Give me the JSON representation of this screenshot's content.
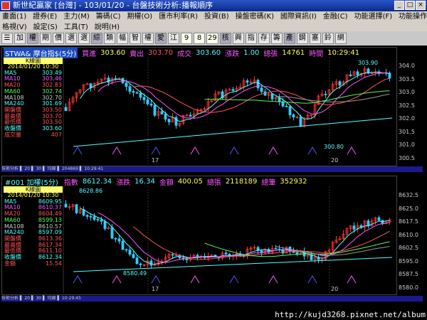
{
  "title": "新世紀贏家 [台灣] - 103/01/20 - 台盤技術分析:播報順序",
  "window_buttons": [
    "_",
    "□",
    "×"
  ],
  "menu": {
    "row1": [
      "畫面(1)",
      "證券(E)",
      "主力(M)",
      "籌碼(C)",
      "期權(O)",
      "匯市利率(R)",
      "投資(B)",
      "操盤密碼(K)",
      "國際資訊(I)",
      "金融(C)",
      "功能選擇(F)",
      "功能操作(F)"
    ],
    "row2": [
      "格視(V)",
      "設定(S)",
      "工具(T)",
      "說明(H)"
    ]
  },
  "toolbar": [
    "☰",
    "加",
    "權",
    "期",
    "價",
    "選",
    "選",
    "綜",
    "類",
    "幅",
    "智",
    "權",
    "愛",
    "江",
    "9",
    "8",
    "29",
    "核",
    "興",
    "指",
    "存",
    "籌",
    "產",
    "鋼",
    "塞",
    "鈴",
    "網"
  ],
  "panel1": {
    "symbol": "STWA& 摩台指$(5分)",
    "bid_label": "買進",
    "bid": "303.60",
    "ask_label": "賣出",
    "ask": "303.70",
    "deal_label": "成交",
    "deal": "303.60",
    "change_label": "漲跌",
    "change": "1.00",
    "volume_label": "總張",
    "volume": "14761",
    "time_label": "時間",
    "time": "10:29:41",
    "legend_title": "K線圖",
    "legend_date": "2014/01/20 10:30",
    "legend": [
      {
        "k": "MA5",
        "v": "303.49",
        "c": "#5ff"
      },
      {
        "k": "MA10",
        "v": "303.46",
        "c": "#f5f"
      },
      {
        "k": "MA20",
        "v": "302.83",
        "c": "#f55"
      },
      {
        "k": "MA60",
        "v": "302.74",
        "c": "#5f5"
      },
      {
        "k": "MA108",
        "v": "302.70",
        "c": "#ccc"
      },
      {
        "k": "MA240",
        "v": "301.69",
        "c": "#5ff"
      },
      {
        "k": "開盤價",
        "v": "303.50",
        "c": "#f55"
      },
      {
        "k": "最高價",
        "v": "303.70",
        "c": "#f55"
      },
      {
        "k": "最低價",
        "v": "303.50",
        "c": "#f55"
      },
      {
        "k": "收盤價",
        "v": "303.60",
        "c": "#5ff"
      },
      {
        "k": "成交量",
        "v": "407",
        "c": "#f55"
      }
    ],
    "axis": [
      "304.0",
      "303.5",
      "303.0",
      "302.5",
      "302.0",
      "301.5",
      "301.0",
      "300.5"
    ],
    "high_label": "303.90",
    "low_label": "300.80",
    "day_labels": [
      "17",
      "20"
    ],
    "status": "技術分析 ▌ 20 ▌ 30 ▌ 均線 ▌ 204869 ▌ 10:29:41"
  },
  "panel2": {
    "symbol": "#001 加權(5分)",
    "index_label": "指數",
    "index": "8612.34",
    "change_label": "漲跌",
    "change": "16.34",
    "amount_label": "金額",
    "amount": "400.05",
    "volume_label": "總張",
    "volume": "2118189",
    "count_label": "總筆",
    "count": "352932",
    "legend_title": "K線圖",
    "legend_date": "2014/01/20 10:30",
    "legend": [
      {
        "k": "MA5",
        "v": "8609.95",
        "c": "#5ff"
      },
      {
        "k": "MA10",
        "v": "8610.37",
        "c": "#f5f"
      },
      {
        "k": "MA20",
        "v": "8604.49",
        "c": "#f55"
      },
      {
        "k": "MA60",
        "v": "8599.13",
        "c": "#5f5"
      },
      {
        "k": "MA108",
        "v": "8610.57",
        "c": "#ccc"
      },
      {
        "k": "MA240",
        "v": "8597.09",
        "c": "#5ff"
      },
      {
        "k": "開盤價",
        "v": "8613.36",
        "c": "#f55"
      },
      {
        "k": "最高價",
        "v": "8617.34",
        "c": "#f55"
      },
      {
        "k": "最低價",
        "v": "8611.10",
        "c": "#f55"
      },
      {
        "k": "收盤價",
        "v": "8612.34",
        "c": "#5ff"
      },
      {
        "k": "金額",
        "v": "15.54",
        "c": "#f55"
      }
    ],
    "axis": [
      "8632.5",
      "8625.0",
      "8617.5",
      "8610.0",
      "8602.5",
      "8595.0",
      "8587.5",
      "8580.0"
    ],
    "high_label": "8628.86",
    "low_label": "8580.49",
    "day_labels": [
      "17",
      "20"
    ],
    "status": "技術分析 ▌ 20 ▌ 30 ▌ 均線 ▌ 10:29:45"
  },
  "watermark": "http://kujd3268.pixnet.net/album"
}
